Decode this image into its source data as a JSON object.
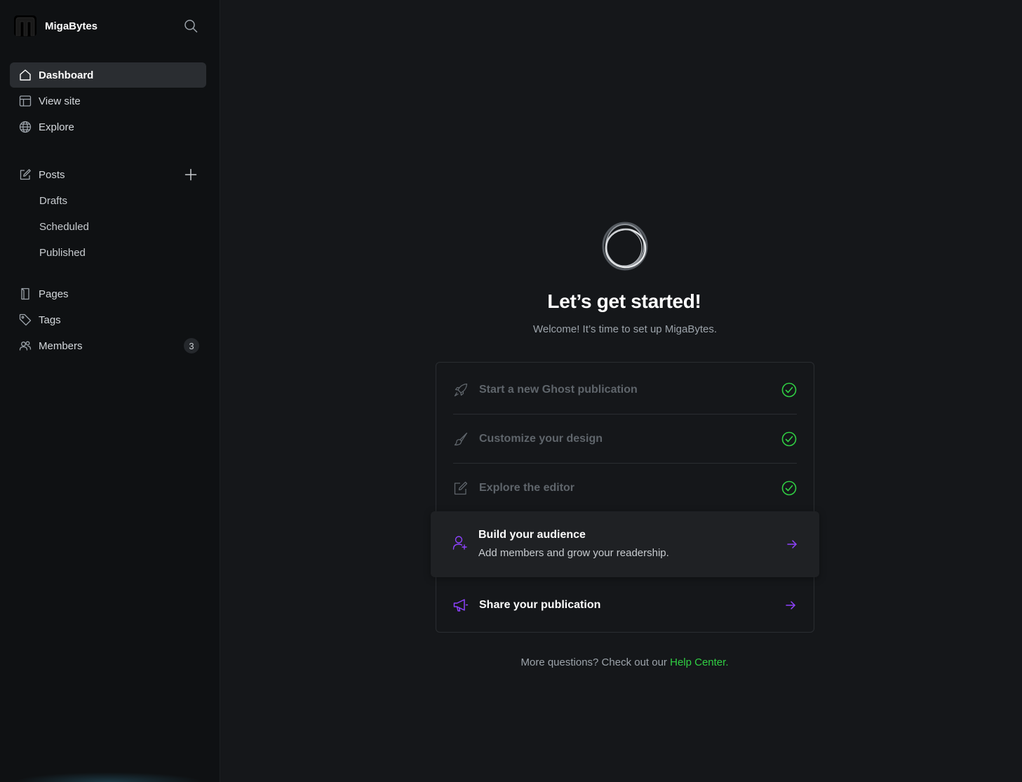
{
  "sidebar": {
    "brand": {
      "name": "MigaBytes"
    },
    "items": [
      {
        "label": "Dashboard",
        "icon": "home-icon",
        "active": true
      },
      {
        "label": "View site",
        "icon": "layout-icon"
      },
      {
        "label": "Explore",
        "icon": "globe-icon"
      }
    ],
    "posts": {
      "label": "Posts",
      "icon": "edit-icon",
      "subitems": [
        {
          "label": "Drafts"
        },
        {
          "label": "Scheduled"
        },
        {
          "label": "Published"
        }
      ]
    },
    "more_items": [
      {
        "label": "Pages",
        "icon": "page-icon"
      },
      {
        "label": "Tags",
        "icon": "tag-icon"
      },
      {
        "label": "Members",
        "icon": "members-icon",
        "badge": "3"
      }
    ]
  },
  "main": {
    "title": "Let’s get started!",
    "subtitle": "Welcome! It’s time to set up MigaBytes.",
    "steps": [
      {
        "label": "Start a new Ghost publication",
        "icon": "rocket-icon",
        "done": true
      },
      {
        "label": "Customize your design",
        "icon": "brush-icon",
        "done": true
      },
      {
        "label": "Explore the editor",
        "icon": "edit-icon",
        "done": true
      },
      {
        "label": "Build your audience",
        "description": "Add members and grow your readership.",
        "icon": "user-add-icon",
        "done": false
      },
      {
        "label": "Share your publication",
        "icon": "megaphone-icon",
        "done": false
      }
    ],
    "footer": {
      "text": "More questions? Check out our ",
      "link": "Help Center."
    }
  },
  "colors": {
    "accent": "#8e42ff",
    "success": "#30cf43",
    "background": "#15171a",
    "sidebar": "#0f1113"
  }
}
